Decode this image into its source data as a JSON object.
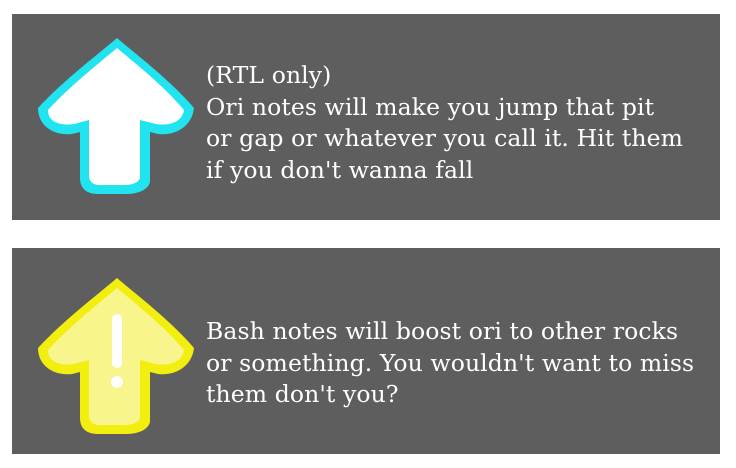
{
  "notes": [
    {
      "icon": "ori-arrow-up-icon",
      "colors": {
        "glow": "#22e4f0",
        "fill": "#ffffff"
      },
      "lines": [
        "(RTL only)",
        "Ori notes will make you jump that pit",
        "or gap or whatever you call it. Hit them",
        "if you don't wanna fall"
      ]
    },
    {
      "icon": "bash-arrow-up-exclamation-icon",
      "colors": {
        "glow": "#f2ef10",
        "fill": "#f7f58c"
      },
      "lines": [
        "Bash notes will boost ori to other rocks",
        "or something. You wouldn't want to miss",
        "them don't you?"
      ]
    }
  ],
  "panel_color": "#5e5e5e"
}
